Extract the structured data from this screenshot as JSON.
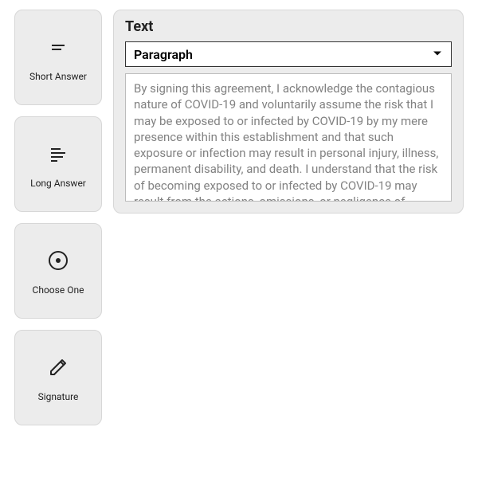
{
  "sidebar": {
    "items": [
      {
        "label": "Short Answer"
      },
      {
        "label": "Long Answer"
      },
      {
        "label": "Choose One"
      },
      {
        "label": "Signature"
      }
    ]
  },
  "editor": {
    "title": "Text",
    "style_selected": "Paragraph",
    "content": "By signing this agreement, I acknowledge the contagious nature of COVID-19 and voluntarily assume the risk that I may be exposed to or infected by COVID-19 by my mere presence within this establishment and that such exposure or infection may result in personal injury, illness, permanent disability, and death. I understand that the risk of becoming exposed to or infected by COVID-19 may result from the actions, omissions, or negligence of myself"
  }
}
